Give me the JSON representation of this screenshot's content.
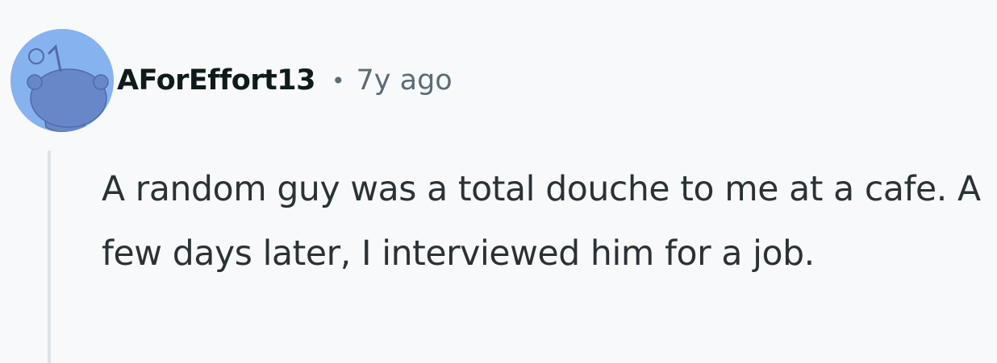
{
  "comment": {
    "author": "AForEffort13",
    "separator": "•",
    "time": "7y ago",
    "body": "A random guy was a total douche to me at a cafe. A few days later, I interviewed him for a job."
  },
  "avatar": {
    "icon": "snoo-avatar-icon",
    "background_color": "#86b2f0",
    "figure_color": "#6787c9"
  },
  "colors": {
    "page_background": "#f8f9fb",
    "author_text": "#0f1a1c",
    "meta_text": "#5c6c74",
    "body_text": "#2a3236",
    "thread_line": "#dde3e8"
  }
}
